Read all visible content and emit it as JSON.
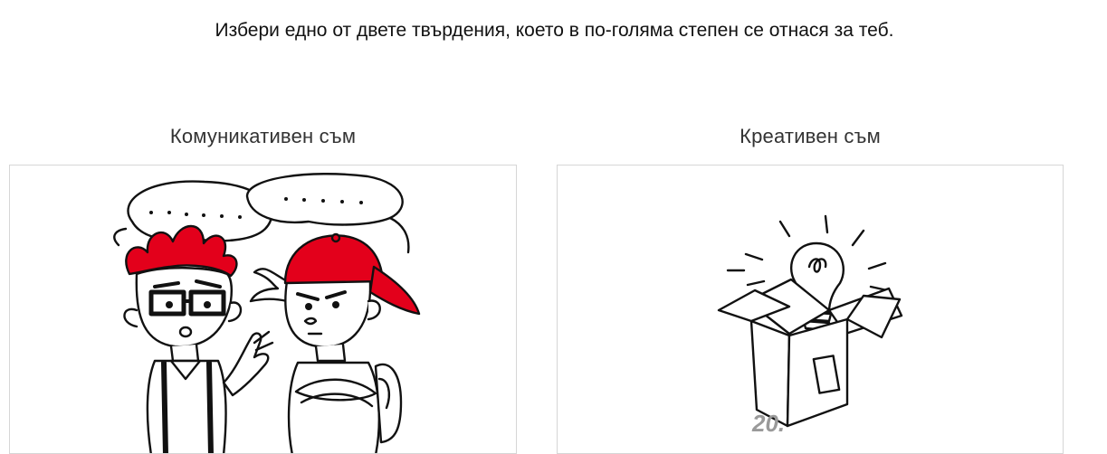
{
  "question": {
    "text": "Избери едно от двете твърдения, което в по-голяма степен се отнася за теб."
  },
  "options": [
    {
      "label": "Комуникативен съм",
      "illustration": "two-talking-boys-illustration"
    },
    {
      "label": "Креативен съм",
      "illustration": "lightbulb-in-box-illustration",
      "badge_text": "20."
    }
  ],
  "colors": {
    "accent_red": "#e3001b",
    "ink": "#111111",
    "card_border": "#d6d6d6"
  }
}
